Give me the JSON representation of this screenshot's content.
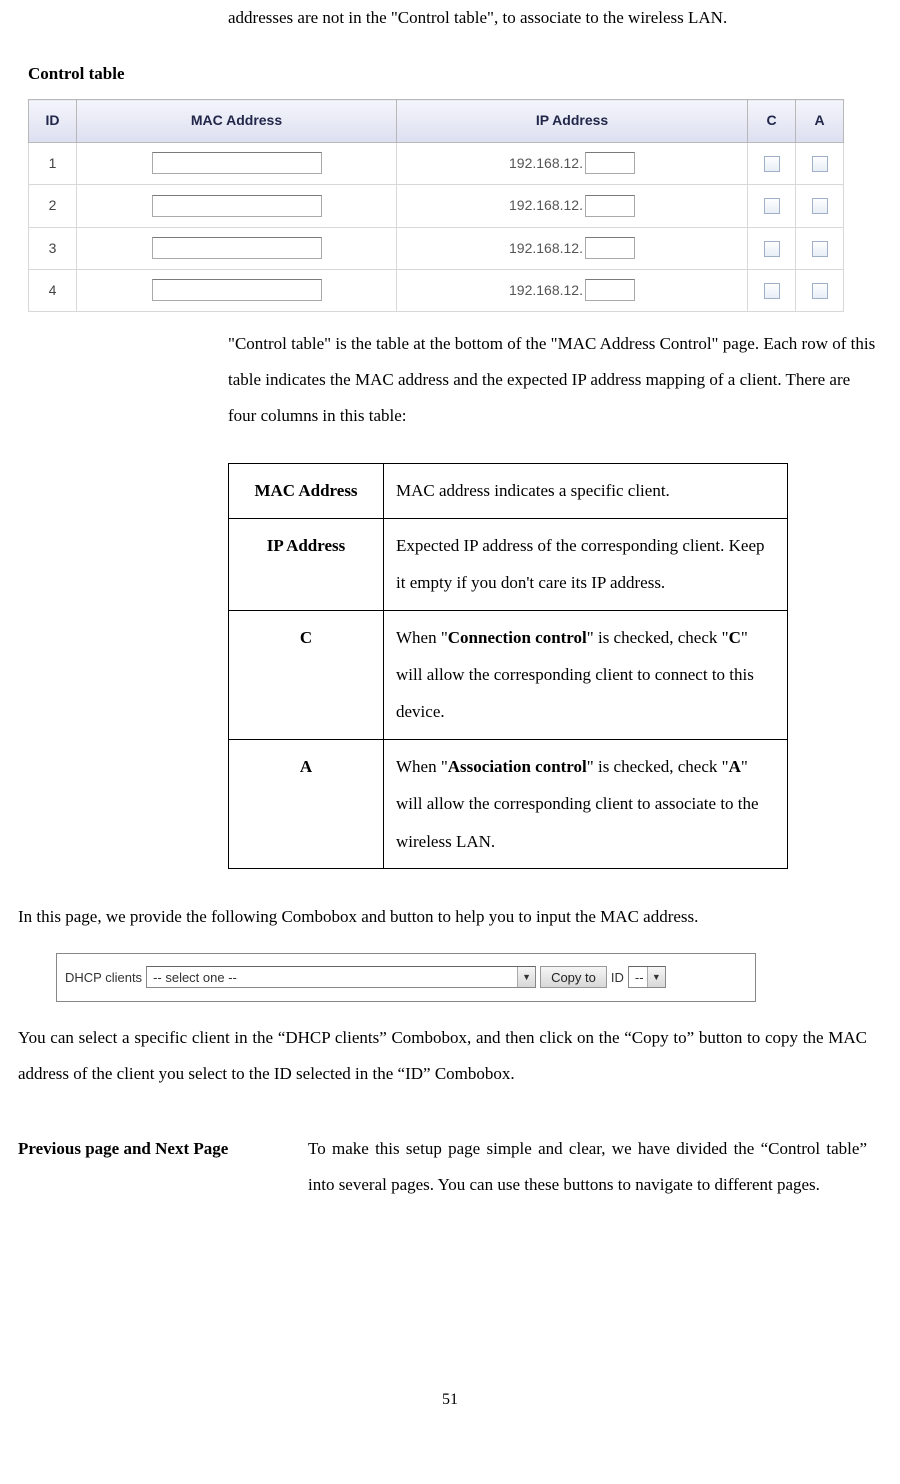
{
  "top_para": "addresses are not in the \"Control table\", to associate to the wireless LAN.",
  "section_title": "Control table",
  "ctl_table": {
    "headers": {
      "id": "ID",
      "mac": "MAC Address",
      "ip": "IP Address",
      "c": "C",
      "a": "A"
    },
    "ip_prefix": "192.168.12.",
    "rows": [
      "1",
      "2",
      "3",
      "4"
    ]
  },
  "desc_para": "\"Control table\" is the table at the bottom of the \"MAC Address Control\" page. Each row of this table indicates the MAC address and the expected IP address mapping of a client. There are four columns in this table:",
  "defs": {
    "mac": {
      "term": "MAC Address",
      "text": "MAC address indicates a specific client."
    },
    "ip": {
      "term": "IP Address",
      "text": "Expected IP address of the corresponding client. Keep it empty if you don't care its IP address."
    },
    "c": {
      "term": "C",
      "pre": "When \"",
      "bold1": "Connection control",
      "mid": "\" is checked, check \"",
      "bold2": "C",
      "post": "\" will allow the corresponding client to connect to this device."
    },
    "a": {
      "term": "A",
      "pre": "When \"",
      "bold1": "Association control",
      "mid": "\" is checked, check \"",
      "bold2": "A",
      "post": "\" will allow the corresponding client to associate to the wireless LAN."
    }
  },
  "combo_intro": "In this page, we provide the following Combobox and button to help you to input the MAC address.",
  "combo": {
    "label_dhcp": "DHCP clients",
    "sel_placeholder": "-- select one --",
    "copy_btn": "Copy to",
    "label_id": "ID",
    "id_placeholder": "--"
  },
  "combo_post": "You can select a specific client in the “DHCP clients” Combobox, and then click on the “Copy to” button to copy the MAC address of the client you select to the ID selected in the “ID” Combobox.",
  "prevnext": {
    "label": "Previous page and Next Page",
    "text": "To make this setup page simple and clear, we have divided the “Control table” into several pages. You can use these buttons to navigate to different pages."
  },
  "page_number": "51"
}
